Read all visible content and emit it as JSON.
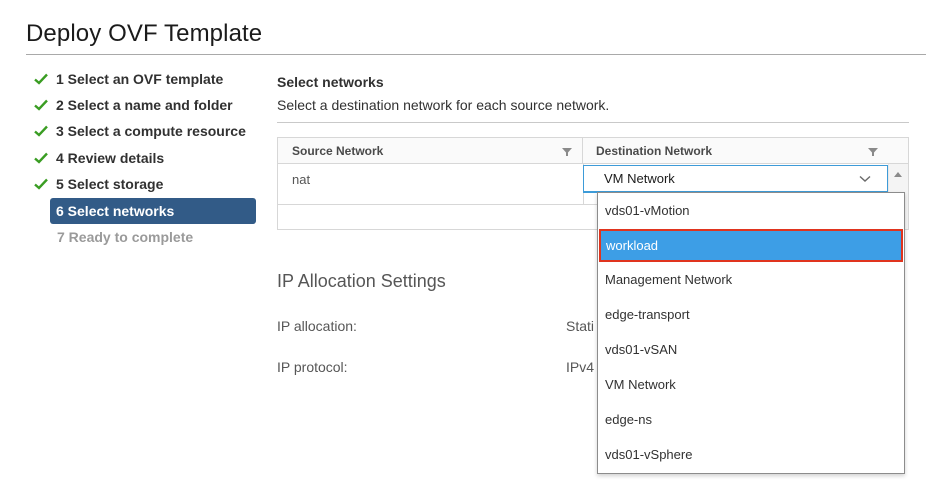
{
  "window": {
    "title": "Deploy OVF Template"
  },
  "steps": [
    {
      "label": "1 Select an OVF template",
      "state": "done"
    },
    {
      "label": "2 Select a name and folder",
      "state": "done"
    },
    {
      "label": "3 Select a compute resource",
      "state": "done"
    },
    {
      "label": "4 Review details",
      "state": "done"
    },
    {
      "label": "5 Select storage",
      "state": "done"
    },
    {
      "label": "6 Select networks",
      "state": "active"
    },
    {
      "label": "7 Ready to complete",
      "state": "disabled"
    }
  ],
  "main": {
    "title": "Select networks",
    "description": "Select a destination network for each source network.",
    "table": {
      "columns": [
        "Source Network",
        "Destination Network"
      ],
      "rows": [
        {
          "source": "nat",
          "destination": "VM Network"
        }
      ]
    },
    "dropdown": {
      "options": [
        "vds01-vMotion",
        "workload",
        "Management Network",
        "edge-transport",
        "vds01-vSAN",
        "VM Network",
        "edge-ns",
        "vds01-vSphere"
      ],
      "highlighted": "workload"
    },
    "ip_settings": {
      "title": "IP Allocation Settings",
      "allocation_label": "IP allocation:",
      "allocation_value": "Stati",
      "protocol_label": "IP protocol:",
      "protocol_value": "IPv4"
    }
  },
  "colors": {
    "check": "#3a9d23",
    "active_step": "#325b87",
    "highlight": "#3d9ee6",
    "highlight_border": "#e0341e"
  }
}
